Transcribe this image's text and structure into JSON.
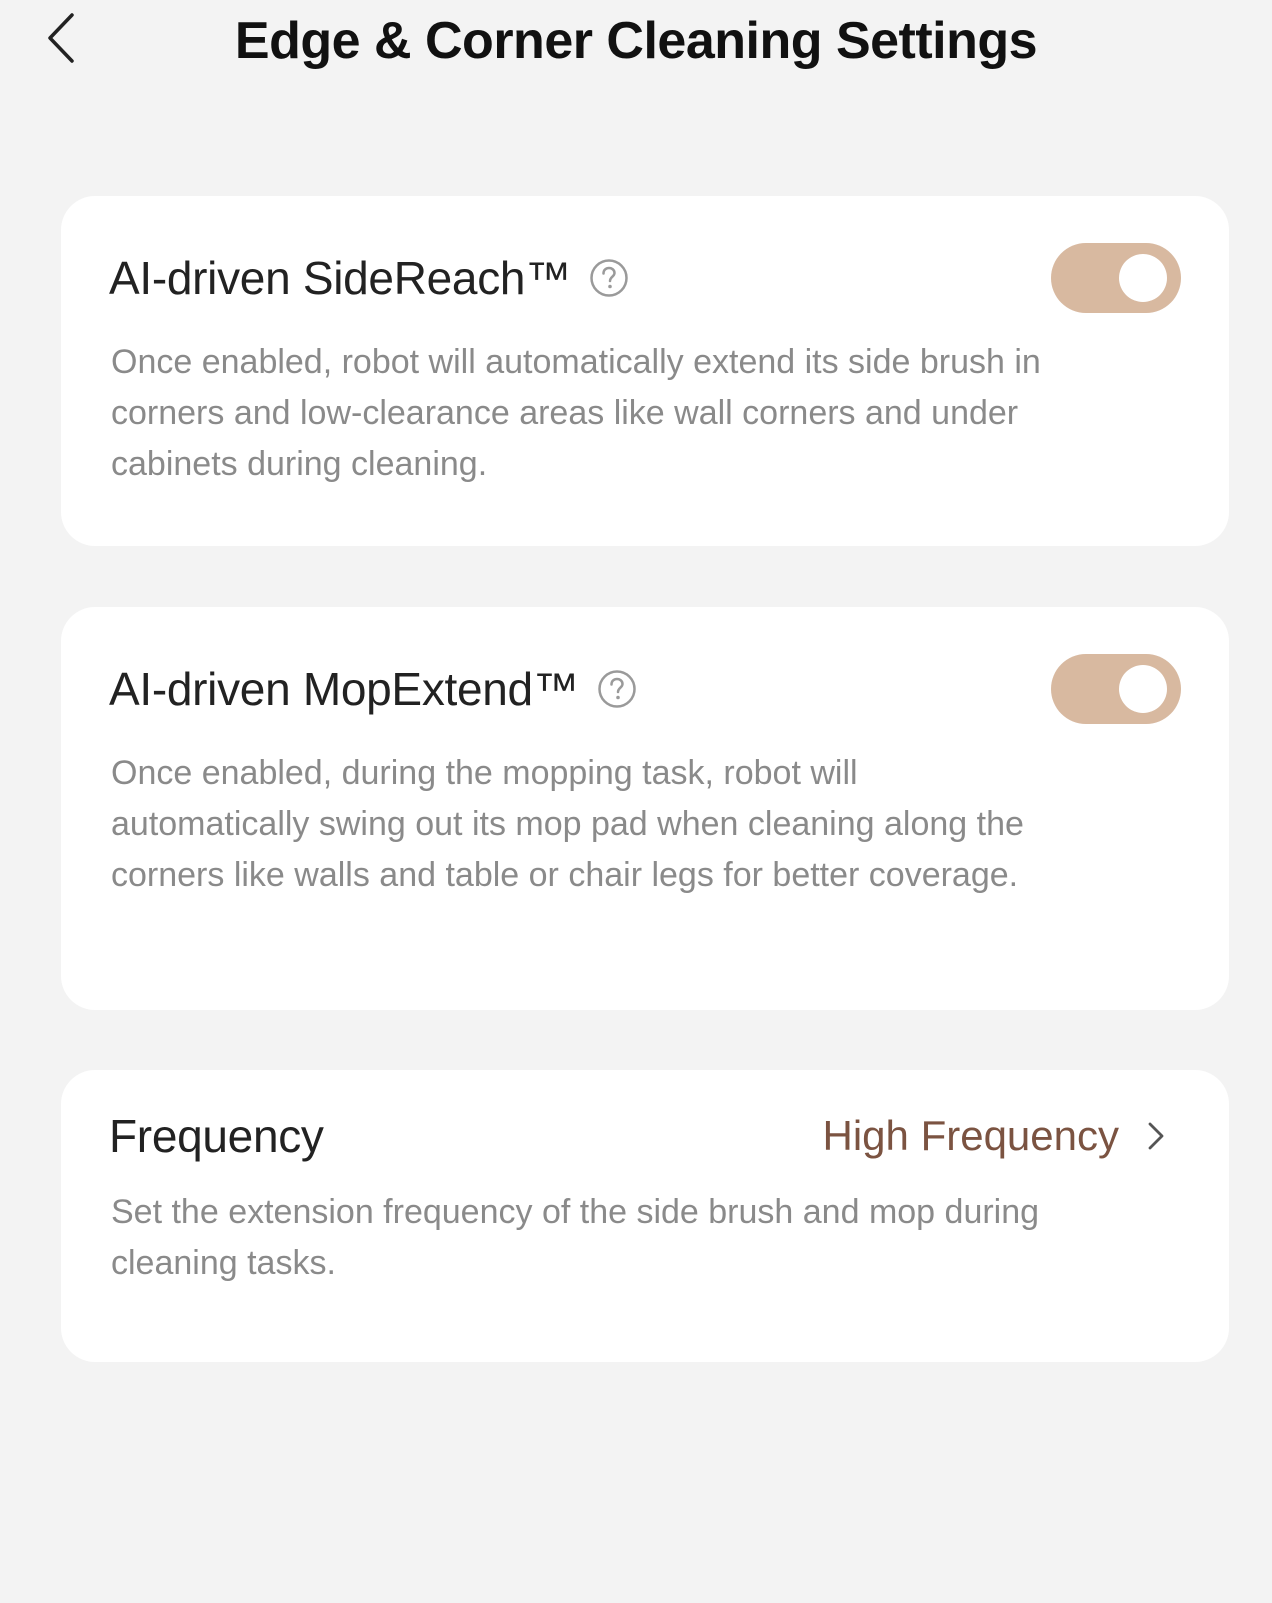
{
  "header": {
    "title": "Edge & Corner Cleaning Settings",
    "back_icon": "chevron-left-icon"
  },
  "settings": [
    {
      "title": "AI-driven SideReach™",
      "help_icon": "help-circle-icon",
      "enabled": true,
      "description": "Once enabled, robot will automatically extend its side brush in corners and low-clearance areas like wall corners and under cabinets during cleaning."
    },
    {
      "title": "AI-driven MopExtend™",
      "help_icon": "help-circle-icon",
      "enabled": true,
      "description": "Once enabled, during the mopping task, robot will automatically swing out its mop pad when cleaning along the corners like walls and table or chair legs for better coverage."
    }
  ],
  "frequency": {
    "label": "Frequency",
    "value": "High Frequency",
    "description": "Set the extension frequency of the side brush and mop during cleaning tasks.",
    "chevron_icon": "chevron-right-icon"
  },
  "colors": {
    "background": "#f3f3f3",
    "card": "#ffffff",
    "toggle_on": "#d8b9a0",
    "accent_text": "#7b5341"
  }
}
